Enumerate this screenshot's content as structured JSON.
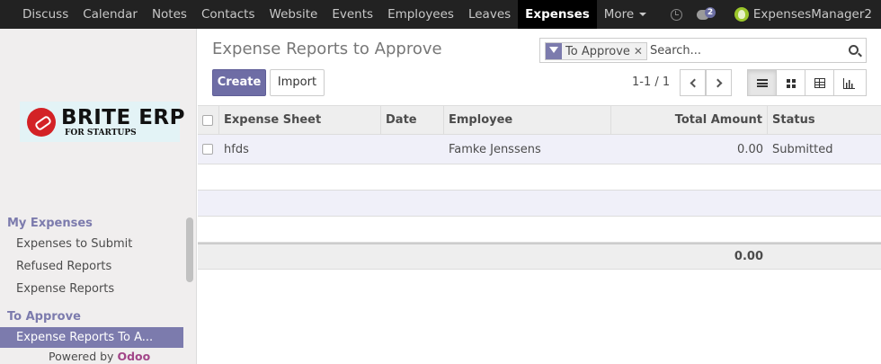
{
  "navbar": {
    "items": [
      "Discuss",
      "Calendar",
      "Notes",
      "Contacts",
      "Website",
      "Events",
      "Employees",
      "Leaves",
      "Expenses",
      "More"
    ],
    "active": "Expenses",
    "chat_count": "2",
    "user": "ExpensesManager2"
  },
  "sidebar": {
    "logo_main": "BRITE ERP",
    "logo_sub": "FOR STARTUPS",
    "sections": [
      {
        "heading": "My Expenses",
        "items": [
          "Expenses to Submit",
          "Refused Reports",
          "Expense Reports"
        ]
      },
      {
        "heading": "To Approve",
        "items": [
          "Expense Reports To A..."
        ]
      }
    ],
    "active_item": "Expense Reports To A...",
    "powered_prefix": "Powered by",
    "powered_brand": "Odoo"
  },
  "control": {
    "title": "Expense Reports to Approve",
    "create_label": "Create",
    "import_label": "Import",
    "pager": "1-1 / 1",
    "search_facet": "To Approve",
    "search_placeholder": "Search...",
    "views": [
      "list-icon",
      "kanban-icon",
      "pivot-icon",
      "graph-icon"
    ],
    "active_view": "list-icon"
  },
  "table": {
    "columns": [
      "Expense Sheet",
      "Date",
      "Employee",
      "Total Amount",
      "Status"
    ],
    "rows": [
      {
        "sheet": "hfds",
        "date": "",
        "employee": "Famke Jenssens",
        "amount": "0.00",
        "status": "Submitted"
      }
    ],
    "footer_total": "0.00"
  },
  "colors": {
    "accent": "#7c7bad",
    "navbar_bg": "#222222",
    "active_nav_bg": "#000000",
    "brand_odoo": "#a24689"
  }
}
